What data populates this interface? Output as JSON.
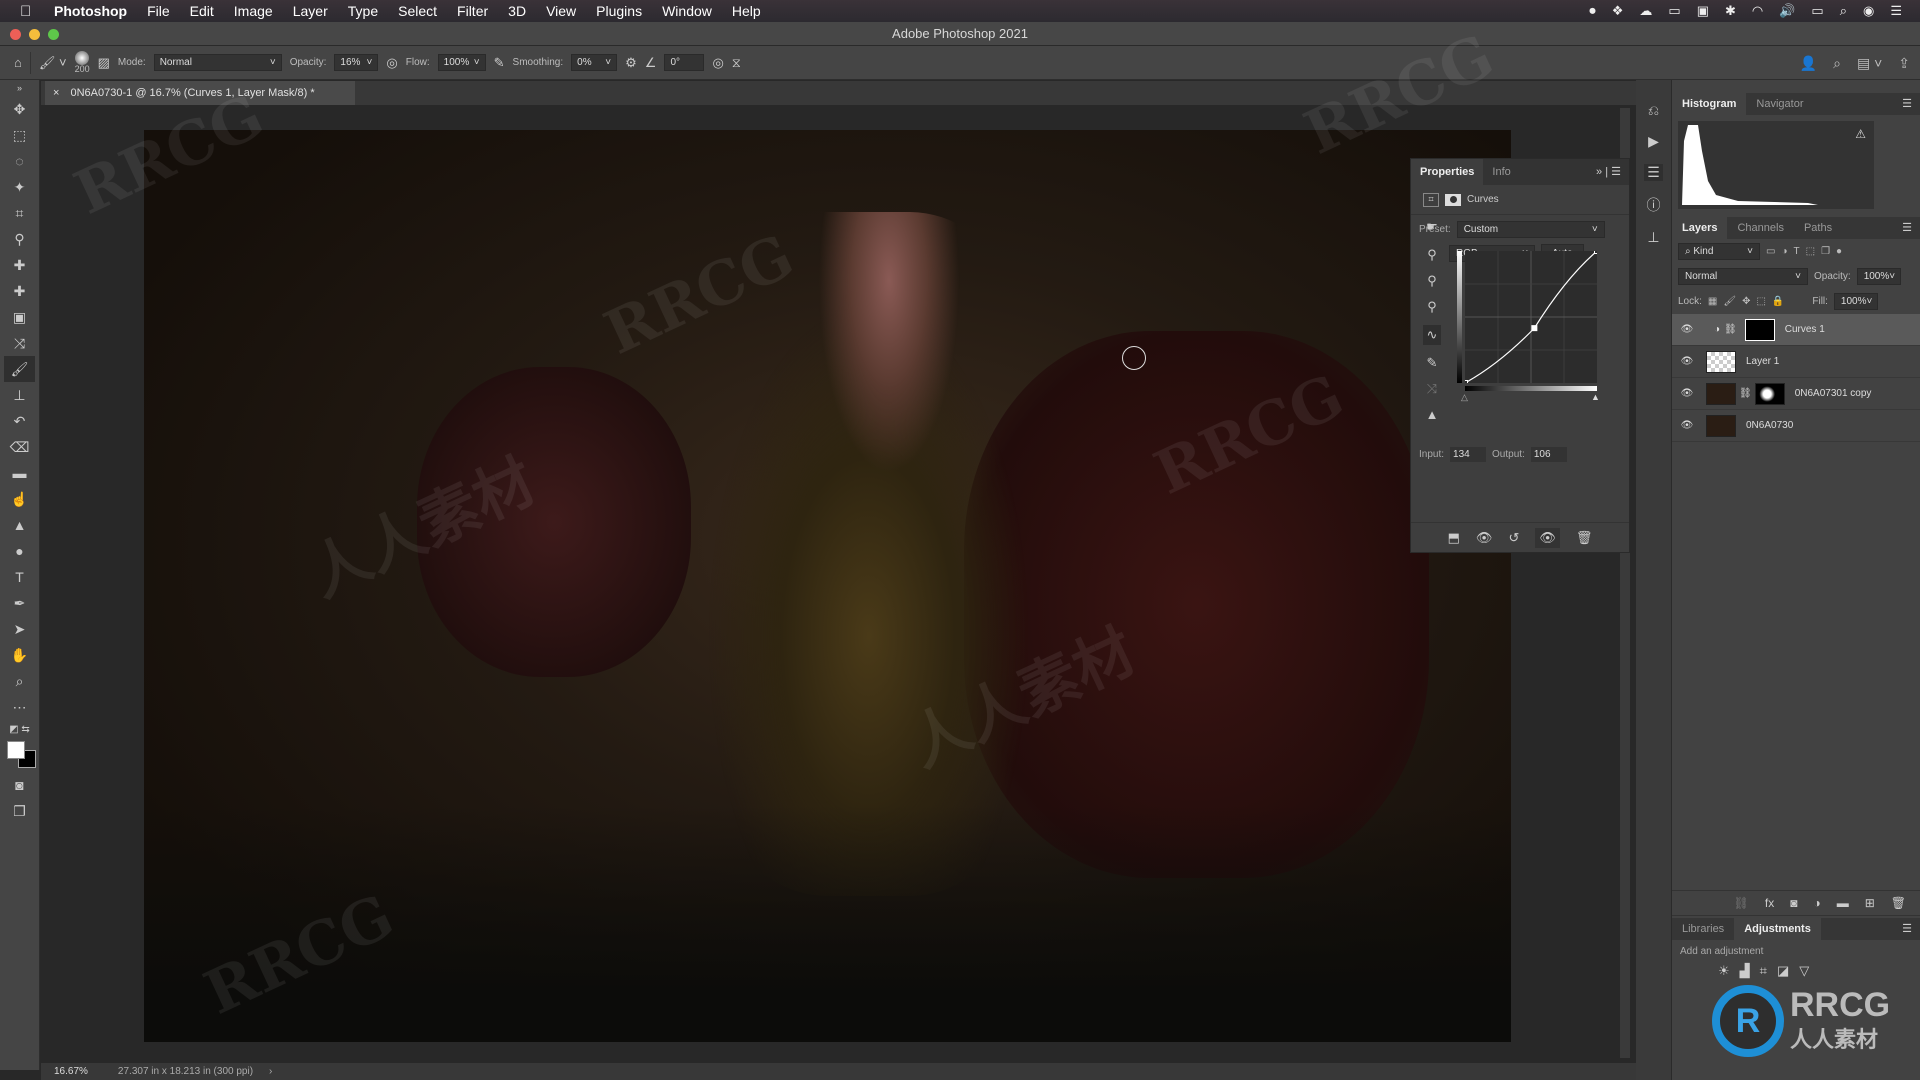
{
  "menubar": {
    "app": "Photoshop",
    "items": [
      "File",
      "Edit",
      "Image",
      "Layer",
      "Type",
      "Select",
      "Filter",
      "3D",
      "View",
      "Plugins",
      "Window",
      "Help"
    ]
  },
  "window": {
    "title": "Adobe Photoshop 2021"
  },
  "options": {
    "brush_size": "200",
    "mode_label": "Mode:",
    "mode_value": "Normal",
    "opacity_label": "Opacity:",
    "opacity_value": "16%",
    "flow_label": "Flow:",
    "flow_value": "100%",
    "smoothing_label": "Smoothing:",
    "smoothing_value": "0%",
    "angle_value": "0°"
  },
  "document": {
    "tab_title": "0N6A0730-1 @ 16.7% (Curves 1, Layer Mask/8) *",
    "zoom": "16.67%",
    "dimensions": "27.307 in x 18.213 in (300 ppi)"
  },
  "properties": {
    "tabs": [
      "Properties",
      "Info"
    ],
    "type": "Curves",
    "preset_label": "Preset:",
    "preset_value": "Custom",
    "channel": "RGB",
    "auto_label": "Auto",
    "input_label": "Input:",
    "input_value": "134",
    "output_label": "Output:",
    "output_value": "106",
    "curve_points": [
      [
        0,
        0
      ],
      [
        134,
        106
      ],
      [
        255,
        255
      ]
    ]
  },
  "histogram": {
    "tabs": [
      "Histogram",
      "Navigator"
    ]
  },
  "layers": {
    "tabs": [
      "Layers",
      "Channels",
      "Paths"
    ],
    "filter_kind": "Kind",
    "blend_mode": "Normal",
    "opacity_label": "Opacity:",
    "opacity_value": "100%",
    "lock_label": "Lock:",
    "fill_label": "Fill:",
    "fill_value": "100%",
    "items": [
      {
        "name": "Curves 1",
        "selected": true
      },
      {
        "name": "Layer 1",
        "selected": false
      },
      {
        "name": "0N6A07301 copy",
        "selected": false
      },
      {
        "name": "0N6A0730",
        "selected": false
      }
    ]
  },
  "adjustments": {
    "tabs": [
      "Libraries",
      "Adjustments"
    ],
    "hint": "Add an adjustment"
  },
  "watermark": {
    "text": "RRCG",
    "sub": "人人素材"
  }
}
